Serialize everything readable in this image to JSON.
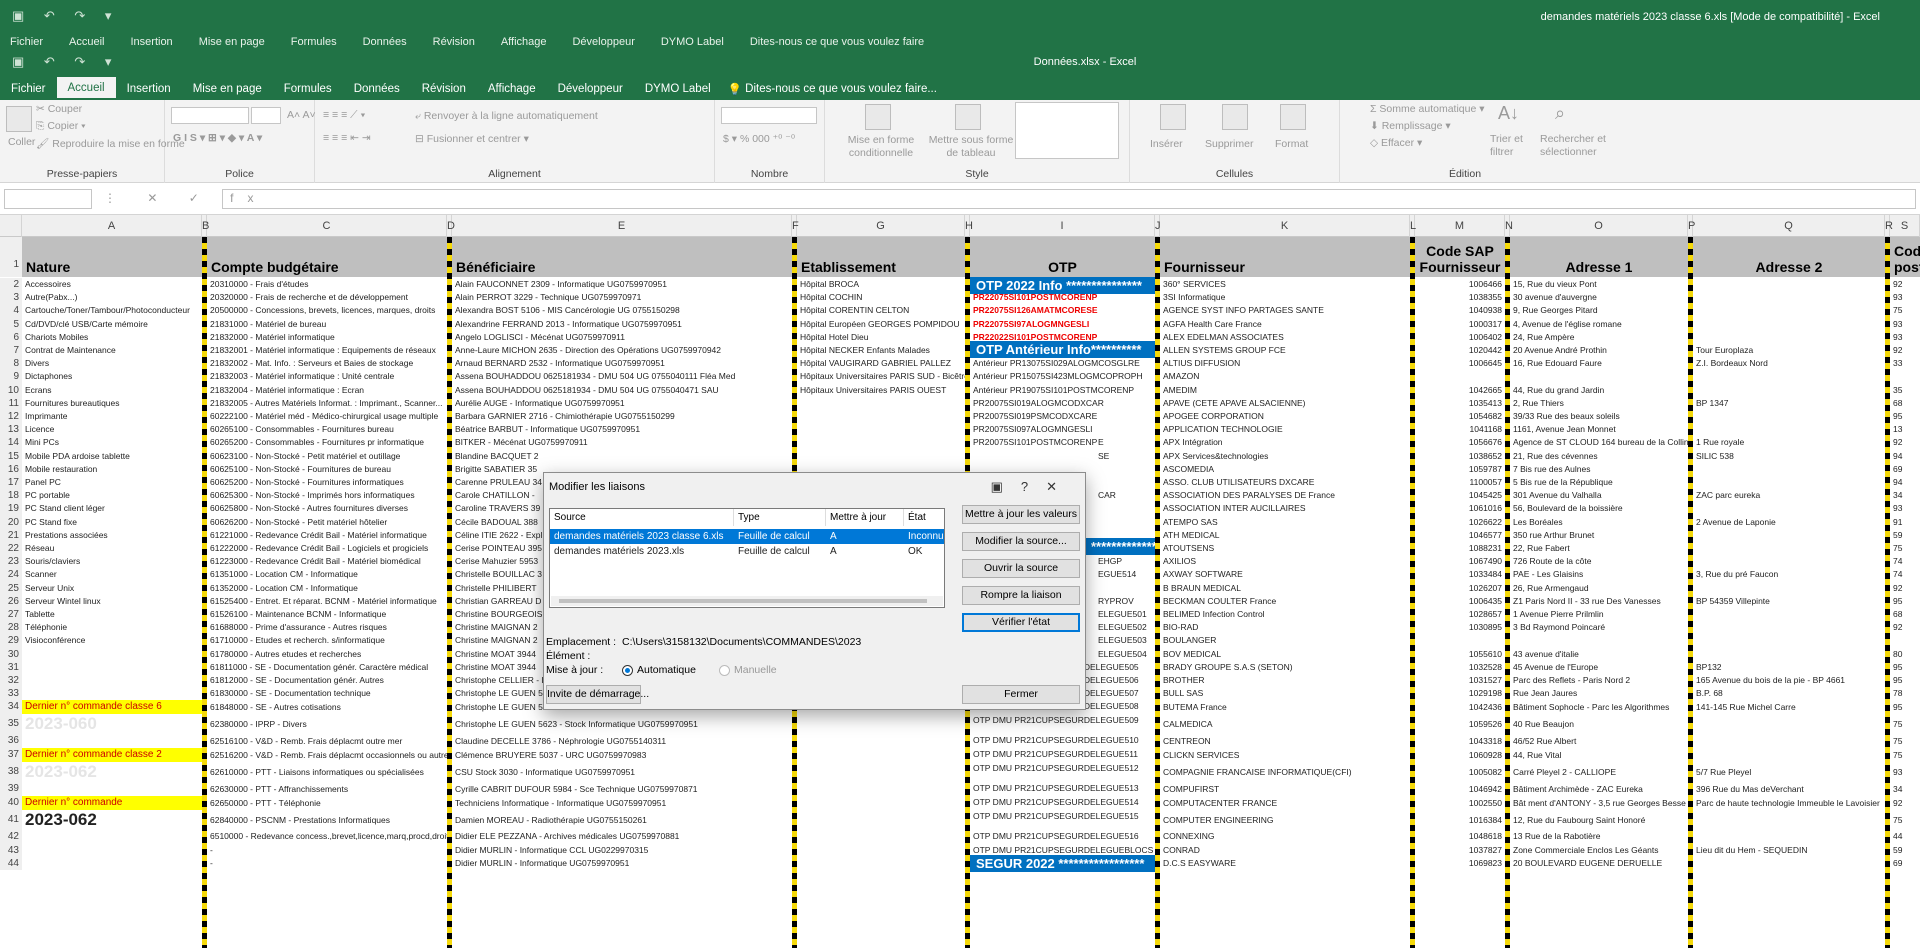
{
  "back_window": {
    "title": "demandes matériels 2023 classe 6.xls  [Mode de compatibilité]  -  Excel",
    "menu": [
      "Fichier",
      "Accueil",
      "Insertion",
      "Mise en page",
      "Formules",
      "Données",
      "Révision",
      "Affichage",
      "Développeur",
      "DYMO Label",
      "Dites-nous ce que vous voulez faire"
    ]
  },
  "window": {
    "title": "Données.xlsx  -  Excel"
  },
  "tabs": [
    "Fichier",
    "Accueil",
    "Insertion",
    "Mise en page",
    "Formules",
    "Données",
    "Révision",
    "Affichage",
    "Développeur",
    "DYMO Label"
  ],
  "tell_me": "Dites-nous ce que vous voulez faire...",
  "ribbon": {
    "clipboard": {
      "coller": "Coller",
      "couper": "Couper",
      "copier": "Copier",
      "repro": "Reproduire la mise en forme",
      "label": "Presse-papiers"
    },
    "police": {
      "label": "Police"
    },
    "alignment": {
      "renvoyer": "Renvoyer à la ligne automatiquement",
      "fusionner": "Fusionner et centrer",
      "label": "Alignement"
    },
    "nombre": {
      "label": "Nombre"
    },
    "style": {
      "mef": "Mise en forme conditionnelle",
      "tableau": "Mettre sous forme de tableau",
      "label": "Style"
    },
    "cellules": {
      "inserer": "Insérer",
      "supprimer": "Supprimer",
      "format": "Format",
      "label": "Cellules"
    },
    "edition": {
      "somme": "Somme automatique",
      "remplissage": "Remplissage",
      "effacer": "Effacer",
      "trier": "Trier et filtrer",
      "rechercher": "Rechercher et sélectionner",
      "label": "Édition"
    }
  },
  "formula_bar": {
    "fx": "fx"
  },
  "columns": [
    "A",
    "B",
    "C",
    "D",
    "E",
    "F",
    "G",
    "H",
    "I",
    "J",
    "K",
    "L",
    "M",
    "N",
    "O",
    "P",
    "Q",
    "R",
    "S"
  ],
  "headers": {
    "A": "Nature",
    "C": "Compte budgétaire",
    "E": "Bénéficiaire",
    "G": "Etablissement",
    "I": "OTP",
    "K": "Fournisseur",
    "M1": "Code SAP",
    "M2": "Fournisseur",
    "O": "Adresse 1",
    "Q": "Adresse 2",
    "S1": "Cod",
    "S2": "post"
  },
  "rows": [
    [
      "2",
      "Accessoires",
      "20310000 - Frais d'études",
      "Alain FAUCONNET 2309 - Informatique UG0759970951",
      "Hôpital BROCA",
      "",
      "360° SERVICES",
      "1006466",
      "15, Rue du vieux Pont",
      "",
      "92"
    ],
    [
      "3",
      "Autre(Pabx...)",
      "20320000 - Frais de recherche et de développement",
      "Alain PERROT 3229 - Technique UG0759970971",
      "Hôpital COCHIN",
      "PR22075SI101POSTMCORENP",
      "3SI Informatique",
      "1038355",
      "30 avenue d'auvergne",
      "",
      "93"
    ],
    [
      "4",
      "Cartouche/Toner/Tambour/Photoconducteur",
      "20500000 - Concessions, brevets, licences, marques, droits",
      "Alexandra BOST 5106 - MIS Cancérologie UG 0755150298",
      "Hôpital CORENTIN CELTON",
      "PR22075SI126AMATMCORESE",
      "AGENCE SYST INFO PARTAGES SANTE",
      "1040938",
      "9, Rue Georges Pitard",
      "",
      "75"
    ],
    [
      "5",
      "Cd/DVD/clé USB/Carte mémoire",
      "21831000 - Matériel de bureau",
      "Alexandrine FERRAND 2013 - Informatique UG0759970951",
      "Hôpital Européen GEORGES POMPIDOU",
      "PR22075SI97ALOGMNGESLI",
      "AGFA Health Care France",
      "1000317",
      "4, Avenue de l'église romane",
      "",
      "93"
    ],
    [
      "6",
      "Chariots Mobiles",
      "21832000 - Matériel informatique",
      "Angelo LOGLISCI - Mécénat UG0759970911",
      "Hôpital Hotel Dieu",
      "PR22022SI101POSTMCORENP",
      "ALEX EDELMAN ASSOCIATES",
      "1006402",
      "24, Rue Ampère",
      "",
      "93"
    ],
    [
      "7",
      "Contrat de Maintenance",
      "21832001 - Matériel informatique : Equipements de réseaux",
      "Anne-Laure MICHON 2635 - Direction des Opérations UG0759970942",
      "Hôpital NECKER Enfants Malades",
      "",
      "ALLEN SYSTEMS GROUP FCE",
      "1020442",
      "20 Avenue André Prothin",
      "Tour Europlaza",
      "92"
    ],
    [
      "8",
      "Divers",
      "21832002 - Mat. Info. : Serveurs et Baies de stockage",
      "Arnaud BERNARD 2532 - Informatique UG0759970951",
      "Hôpital VAUGIRARD GABRIEL PALLEZ",
      "Antérieur PR13075SI029ALOGMCOSGLRE",
      "ALTIUS DIFFUSION",
      "1006645",
      "16, Rue Edouard Faure",
      "Z.I. Bordeaux Nord",
      "33"
    ],
    [
      "9",
      "Dictaphones",
      "21832003 - Matériel informatique : Unité centrale",
      "Assena BOUHADDOU 0625181934 - DMU 504 UG 0755040111 Fléa Med",
      "Hôpitaux Universitaires PARIS SUD - Bicêtre",
      "Antérieur PR15075SI423MLOGMCOPROPH",
      "AMAZON",
      "",
      "",
      "",
      ""
    ],
    [
      "10",
      "Ecrans",
      "21832004 - Matériel informatique : Ecran",
      "Assena BOUHADDOU 0625181934 - DMU 504 UG 0755040471 SAU",
      "Hôpitaux Universitaires PARIS OUEST",
      "Antérieur PR19075SI101POSTMCORENP",
      "AMEDIM",
      "1042665",
      "44, Rue du grand Jardin",
      "",
      "35"
    ],
    [
      "11",
      "Fournitures bureautiques",
      "21832005 - Autres Matériels Informat. : Imprimant., Scanner...",
      "Aurélie AUGE - Informatique UG0759970951",
      "",
      "PR20075SI019ALOGMCODXCAR",
      "APAVE (CETE APAVE ALSACIENNE)",
      "1035413",
      "2, Rue Thiers",
      "BP 1347",
      "68"
    ],
    [
      "12",
      "Imprimante",
      "60222100 - Matériel méd - Médico-chirurgical usage multiple",
      "Barbara GARNIER 2716 - Chimiothérapie UG0755150299",
      "",
      "PR20075SI019PSMCODXCARE",
      "APOGEE CORPORATION",
      "1054682",
      "39/33 Rue des beaux soleils",
      "",
      "95"
    ],
    [
      "13",
      "Licence",
      "60265100 - Consommables - Fournitures bureau",
      "Béatrice BARBUT - Informatique UG0759970951",
      "",
      "PR20075SI097ALOGMNGESLI",
      "APPLICATION TECHNOLOGIE",
      "1041168",
      "1161, Avenue Jean Monnet",
      "",
      "13"
    ],
    [
      "14",
      "Mini PCs",
      "60265200 - Consommables - Fournitures pr informatique",
      "BITKER - Mécénat UG0759970911",
      "",
      "PR20075SI101POSTMCORENP",
      "APX Intégration",
      "1056676",
      "Agence de ST CLOUD 164 bureau de la Colline",
      "1 Rue royale",
      "92"
    ],
    [
      "15",
      "Mobile PDA ardoise tablette",
      "60623100 - Non-Stocké - Petit matériel et outillage",
      "Blandine BACQUET 2",
      "",
      "",
      "APX Services&technologies",
      "1038652",
      "21, Rue des cévennes",
      "SILIC 538",
      "94"
    ],
    [
      "16",
      "Mobile restauration",
      "60625100 - Non-Stocké - Fournitures de bureau",
      "Brigitte SABATIER 35",
      "",
      "",
      "ASCOMEDIA",
      "1059787",
      "7 Bis rue des Aulnes",
      "",
      "69"
    ],
    [
      "17",
      "Panel PC",
      "60625200 - Non-Stocké - Fournitures informatiques",
      "Carenne PRULEAU 34",
      "",
      "",
      "ASSO. CLUB UTILISATEURS DXCARE",
      "1100057",
      "5 Bis rue de la République",
      "",
      "94"
    ],
    [
      "18",
      "PC portable",
      "60625300 - Non-Stocké - Imprimés hors informatiques",
      "Carole CHATILLON -",
      "",
      "",
      "ASSOCIATION DES PARALYSES DE France",
      "1045425",
      "301 Avenue du Valhalla",
      "ZAC parc eureka",
      "34"
    ],
    [
      "19",
      "PC Stand client léger",
      "60625800 - Non-Stocké - Autres fournitures diverses",
      "Caroline TRAVERS 39",
      "",
      "",
      "ASSOCIATION INTER AUCILLAIRES",
      "1061016",
      "56, Boulevard de la boissière",
      "",
      "93"
    ],
    [
      "20",
      "PC Stand fixe",
      "60626200 - Non-Stocké - Petit matériel hôtelier",
      "Cécile BADOUAL 388",
      "",
      "",
      "ATEMPO SAS",
      "1026622",
      "Les Boréales",
      "2 Avenue de Laponie",
      "91"
    ],
    [
      "21",
      "Prestations associées",
      "61221000 - Redevance Crédit Bail - Matériel informatique",
      "Céline ITIE 2622 - Expl",
      "",
      "",
      "ATH MEDICAL",
      "1046577",
      "350 rue Arthur Brunet",
      "",
      "59"
    ],
    [
      "22",
      "Réseau",
      "61222000 - Redevance Crédit Bail - Logiciels et progiciels",
      "Cerise POINTEAU 395",
      "",
      "",
      "ATOUTSENS",
      "1088231",
      "22, Rue Fabert",
      "",
      "75"
    ],
    [
      "23",
      "Souris/claviers",
      "61223000 - Redevance Crédit Bail - Matériel biomédical",
      "Cerise Mahuzier 5953",
      "",
      "",
      "AXILIOS",
      "1067490",
      "726 Route de la côte",
      "",
      "74"
    ],
    [
      "24",
      "Scanner",
      "61351000 - Location CM - Informatique",
      "Christelle BOUILLAC 3",
      "",
      "",
      "AXWAY SOFTWARE",
      "1033484",
      "PAE - Les Glaisins",
      "3, Rue du pré Faucon",
      "74"
    ],
    [
      "25",
      "Serveur Unix",
      "61352000 - Location CM - Informatique",
      "Christelle PHILIBERT",
      "",
      "",
      "B BRAUN MEDICAL",
      "1026207",
      "26, Rue Armengaud",
      "",
      "92"
    ],
    [
      "26",
      "Serveur Wintel linux",
      "61525400 - Entret. Et réparat. BCNM - Matériel informatique",
      "Christian GARREAU D",
      "",
      "",
      "BECKMAN COULTER France",
      "1006435",
      "Z1 Paris Nord II - 33 rue Des Vanesses",
      "BP 54359 Villepinte",
      "95"
    ],
    [
      "27",
      "Tablette",
      "61526100 - Maintenance BCNM - Informatique",
      "Christine BOURGEOIS",
      "",
      "",
      "BELIMED Infection Control",
      "1028657",
      "1 Avenue Pierre Prilmlin",
      "",
      "68"
    ],
    [
      "28",
      "Téléphonie",
      "61688000 - Prime d'assurance - Autres risques",
      "Christine MAIGNAN 2",
      "",
      "",
      "BIO-RAD",
      "1030895",
      "3 Bd Raymond Poincaré",
      "",
      "92"
    ],
    [
      "29",
      "Visioconférence",
      "61710000 - Etudes et recherch. s/informatique",
      "Christine MAIGNAN 2",
      "",
      "",
      "BOULANGER",
      "",
      "",
      "",
      ""
    ],
    [
      "30",
      "",
      "61780000 - Autres etudes et recherches",
      "Christine MOAT 3944",
      "",
      "",
      "BOV MEDICAL",
      "1055610",
      "43 avenue d'italie",
      "",
      "80"
    ],
    [
      "31",
      "",
      "61811000 - SE - Documentation génér. Caractère médical",
      "Christine MOAT 3944",
      "",
      "",
      "BRADY GROUPE S.A.S (SETON)",
      "1032528",
      "45 Avenue de l'Europe",
      "BP132",
      "95"
    ],
    [
      "32",
      "",
      "61812000 - SE - Documentation génér. Autres",
      "Christophe CELLIER - Hépato-Gastro UG0755150195",
      "",
      "",
      "BROTHER",
      "1031527",
      "Parc des Reflets - Paris Nord 2",
      "165 Avenue du bois de la pie - BP 4661",
      "95"
    ],
    [
      "33",
      "",
      "61830000 - SE - Documentation technique",
      "Christophe LE GUEN 5623 - Informatique UG0759970951",
      "",
      "",
      "BULL SAS",
      "1029198",
      "Rue Jean Jaures",
      "B.P. 68",
      "78"
    ],
    [
      "34",
      "Dernier n° commande classe 6",
      "61848000 - SE - Autres cotisations",
      "Christophe LE GUEN 5623 - Stock CSU UG0759970951",
      "",
      "",
      "BUTEMA France",
      "1042436",
      "Bâtiment Sophocle - Parc les Algorithmes",
      "141-145 Rue Michel Carre",
      "95"
    ],
    [
      "35",
      "2023-060",
      "62380000 - IPRP - Divers",
      "Christophe LE GUEN 5623 - Stock Informatique UG0759970951",
      "",
      "",
      "CALMEDICA",
      "1059526",
      "40 Rue Beaujon",
      "",
      "75"
    ],
    [
      "36",
      "",
      "62516100 - V&D - Remb. Frais déplacmt outre mer",
      "Claudine DECELLE 3786 - Néphrologie UG0755140311",
      "",
      "",
      "CENTREON",
      "1043318",
      "46/52 Rue Albert",
      "",
      "75"
    ],
    [
      "37",
      "Dernier n° commande classe 2",
      "62516200 - V&D - Remb. Frais déplacmt occasionnels ou autres",
      "Clémence BRUYERE 5037 - URC UG0759970983",
      "",
      "",
      "CLICKN SERVICES",
      "1060928",
      "44, Rue Vital",
      "",
      "75"
    ],
    [
      "38",
      "2023-062",
      "62610000 - PTT - Liaisons informatiques ou spécialisées",
      "CSU Stock 3030 - Informatique UG0759970951",
      "",
      "",
      "COMPAGNIE FRANCAISE INFORMATIQUE(CFI)",
      "1005082",
      "Carré Pleyel 2 - CALLIOPE",
      "5/7 Rue Pleyel",
      "93"
    ],
    [
      "39",
      "",
      "62630000 - PTT - Affranchissements",
      "Cyrille CABRIT DUFOUR 5984 - Sce Technique UG0759970871",
      "",
      "",
      "COMPUFIRST",
      "1046942",
      "Bâtiment Archimède - ZAC Eureka",
      "396 Rue du Mas deVerchant",
      "34"
    ],
    [
      "40",
      "Dernier n° commande",
      "62650000 - PTT - Téléphonie",
      "Techniciens Informatique - Informatique UG0759970951",
      "",
      "",
      "COMPUTACENTER FRANCE",
      "1002550",
      "Bât ment d'ANTONY - 3,5 rue Georges Besse",
      "Parc de haute technologie Immeuble le Lavoisier",
      "92"
    ],
    [
      "41",
      "2023-062",
      "62840000 - PSCNM - Prestations Informatiques",
      "Damien MOREAU - Radiothérapie UG0755150261",
      "",
      "",
      "COMPUTER ENGINEERING",
      "1016384",
      "12, Rue du Faubourg Saint Honoré",
      "",
      "75"
    ],
    [
      "42",
      "",
      "6510000 - Redevance concess.,brevet,licence,marq,procd,droit",
      "Didier ELE PEZZANA - Archives médicales UG0759970881",
      "",
      "",
      "CONNEXING",
      "1048618",
      "13 Rue de la Rabotière",
      "",
      "44"
    ],
    [
      "43",
      "",
      "-",
      "Didier MURLIN - Informatique CCL UG0229970315",
      "",
      "OTP DMU PR21CUPSEGURDELEGUEBLOCS",
      "CONRAD",
      "1037827",
      "Zone Commerciale Enclos Les Géants",
      "Lieu dit du Hem - SEQUEDIN",
      "59"
    ],
    [
      "44",
      "",
      "-",
      "Didier MURLIN - Informatique UG0759970951",
      "",
      "",
      "D.C.S EASYWARE",
      "1069823",
      "20 BOULEVARD EUGENE DERUELLE",
      "",
      "69"
    ]
  ],
  "otp_extra": {
    "r18": "CAR",
    "r23": "EHGP",
    "r24": "EGUE514",
    "r26": "RYPROV",
    "r27": "ELEGUE501",
    "r28": "ELEGUE502",
    "r29": "ELEGUE503",
    "r30": "ELEGUE504",
    "r31": "OTP DMU PR21CUPSEGURDELEGUE505",
    "r32": "OTP DMU PR21CUPSEGURDELEGUE506",
    "r33": "OTP DMU PR21CUPSEGURDELEGUE507",
    "r34": "OTP DMU PR21CUPSEGURDELEGUE508",
    "r35": "OTP DMU PR21CUPSEGURDELEGUE509",
    "r36": "OTP DMU PR21CUPSEGURDELEGUE510",
    "r37": "OTP DMU PR21CUPSEGURDELEGUE511",
    "r38": "OTP DMU PR21CUPSEGURDELEGUE512",
    "r39": "OTP DMU PR21CUPSEGURDELEGUE513",
    "r40": "OTP DMU PR21CUPSEGURDELEGUE514",
    "r41": "OTP DMU PR21CUPSEGURDELEGUE515",
    "r42": "OTP DMU PR21CUPSEGURDELEGUE516",
    "r14b": "E",
    "r15": "SE"
  },
  "bands": {
    "otp2022": "OTP 2022 Info ***************",
    "otp_ant": "OTP Antérieur Info**********",
    "segur": "SEGUR 2022 *****************",
    "segur_top": "********************"
  },
  "dialog": {
    "title": "Modifier les liaisons",
    "help": "?",
    "cols": [
      "Source",
      "Type",
      "Mettre à jour",
      "État"
    ],
    "links": [
      {
        "source": "demandes matériels 2023 classe 6.xls",
        "type": "Feuille de calcul",
        "update": "A",
        "state": "Inconnu"
      },
      {
        "source": "demandes matériels 2023.xls",
        "type": "Feuille de calcul",
        "update": "A",
        "state": "OK"
      }
    ],
    "buttons": {
      "update": "Mettre à jour les valeurs",
      "change": "Modifier la source...",
      "open": "Ouvrir la source",
      "break": "Rompre la liaison",
      "check": "Vérifier l'état",
      "startup": "Invite de démarrage...",
      "close": "Fermer"
    },
    "emplacement_label": "Emplacement :",
    "emplacement": "C:\\Users\\3158132\\Documents\\COMMANDES\\2023",
    "element_label": "Élément :",
    "maj_label": "Mise à jour :",
    "auto": "Automatique",
    "manual": "Manuelle"
  }
}
